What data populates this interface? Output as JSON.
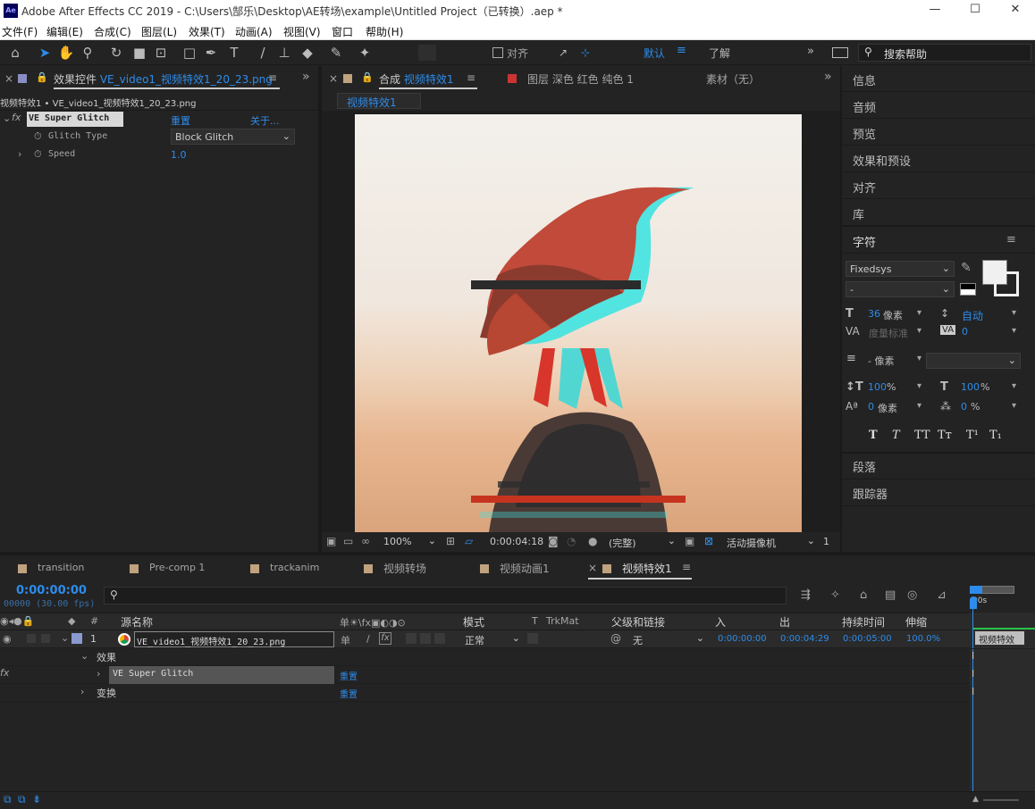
{
  "window": {
    "title": "Adobe After Effects CC 2019 - C:\\Users\\郜乐\\Desktop\\AE转场\\example\\Untitled Project（已转换）.aep *",
    "logo": "Ae",
    "minimize": "—",
    "maximize": "☐",
    "close": "✕"
  },
  "menu": [
    "文件(F)",
    "编辑(E)",
    "合成(C)",
    "图层(L)",
    "效果(T)",
    "动画(A)",
    "视图(V)",
    "窗口",
    "帮助(H)"
  ],
  "toolbar": {
    "align_label": "对齐",
    "workspace": "默认",
    "learn": "了解",
    "search_placeholder": "搜索帮助"
  },
  "effect_controls": {
    "tab_prefix": "效果控件",
    "tab_file": "VE_video1_视频特效1_20_23.png",
    "breadcrumb": "视频特效1 • VE_video1_视频特效1_20_23.png",
    "effect_name": "VE Super Glitch",
    "reset": "重置",
    "about": "关于...",
    "glitch_type_label": "Glitch Type",
    "glitch_type_value": "Block Glitch",
    "speed_label": "Speed",
    "speed_value": "1.0"
  },
  "composition": {
    "tab_prefix": "合成",
    "tab_name": "视频特效1",
    "layer_tab": "图层 深色 红色 纯色 1",
    "footage_tab": "素材（无）",
    "sub_tab": "视频特效1",
    "zoom": "100%",
    "timecode": "0:00:04:18",
    "quality": "(完整)",
    "camera": "活动摄像机",
    "views": "1"
  },
  "right_panel": {
    "items": [
      "信息",
      "音频",
      "预览",
      "效果和预设",
      "对齐",
      "库"
    ],
    "character": "字符",
    "font": "Fixedsys",
    "font_style": "-",
    "size": "36",
    "size_unit": "像素",
    "leading": "自动",
    "kerning_label": "度量标准",
    "tracking": "0",
    "stroke": "-",
    "stroke_unit": "像素",
    "vscale": "100",
    "hscale": "100",
    "pct": "%",
    "baseline": "0",
    "baseline_unit": "像素",
    "tsume": "0",
    "tsume_unit": "%",
    "styles": [
      "T",
      "T",
      "TT",
      "Tт",
      "T¹",
      "T₁"
    ],
    "paragraph": "段落",
    "tracker": "跟踪器"
  },
  "timeline": {
    "tabs": [
      "transition",
      "Pre-comp 1",
      "trackanim",
      "视频转场",
      "视频动画1",
      "视频特效1"
    ],
    "timecode": "0:00:00:00",
    "fps": "00000 (30.00 fps)",
    "cols": {
      "num": "#",
      "source": "源名称",
      "mode": "模式",
      "t": "T",
      "trkmat": "TrkMat",
      "parent": "父级和链接",
      "in": "入",
      "out": "出",
      "duration": "持续时间",
      "stretch": "伸缩"
    },
    "layer": {
      "index": "1",
      "name": "VE_video1_视频特效1_20_23.png",
      "mode": "正常",
      "parent": "无",
      "in": "0:00:00:00",
      "out": "0:00:04:29",
      "duration": "0:00:05:00",
      "stretch": "100.0%"
    },
    "effects_label": "效果",
    "effect_name": "VE Super Glitch",
    "transform_label": "变换",
    "reset": "重置",
    "ruler": "00s",
    "bar_label": "视频特效"
  }
}
